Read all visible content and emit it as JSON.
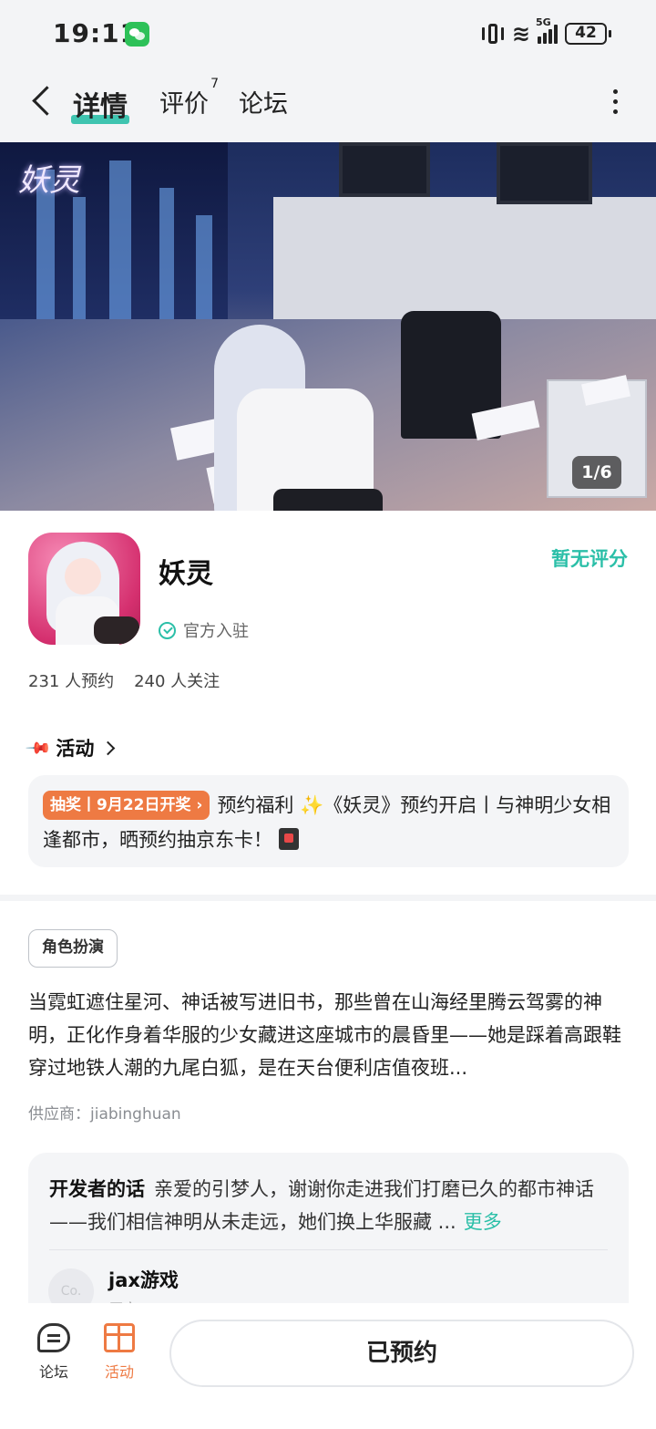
{
  "status_bar": {
    "time": "19:11",
    "network": "5G",
    "battery": "42",
    "icons": [
      "wechat-icon",
      "vibrate-icon",
      "wifi-icon",
      "signal-icon",
      "battery-icon"
    ]
  },
  "nav": {
    "tabs": [
      {
        "label": "详情",
        "active": true
      },
      {
        "label": "评价",
        "badge": "7"
      },
      {
        "label": "论坛"
      }
    ]
  },
  "banner": {
    "logo_text": "妖灵",
    "counter": "1/6"
  },
  "app": {
    "name": "妖灵",
    "official": "官方入驻",
    "rating": "暂无评分",
    "reservations": "231 人预约",
    "followers": "240 人关注"
  },
  "activity": {
    "heading": "活动",
    "badge": "抽奖丨9月22日开奖",
    "text_part1": "预约福利",
    "text_part2": "《妖灵》预约开启丨与神明少女相逢都市，晒预约抽京东卡！"
  },
  "description": {
    "tag": "角色扮演",
    "text": "当霓虹遮住星河、神话被写进旧书，那些曾在山海经里腾云驾雾的神明，正化作身着华服的少女藏进这座城市的晨昏里——她是踩着高跟鞋穿过地铁人潮的九尾白狐，是在天台便利店值夜班...",
    "supplier": "供应商：jiabinghuan"
  },
  "developer": {
    "label": "开发者的话",
    "text": "亲爱的引梦人，谢谢你走进我们打磨已久的都市神话——我们相信神明从未走远，她们换上华服藏 ...",
    "more": "更多",
    "avatar_text": "Co.",
    "name": "jax游戏",
    "role": "厂商"
  },
  "bottom": {
    "forum_label": "论坛",
    "activity_label": "活动",
    "reserve_button": "已预约"
  },
  "colors": {
    "accent_teal": "#2bbfa8",
    "accent_orange": "#ee7a43",
    "background": "#ffffff",
    "card_bg": "#f4f5f7"
  }
}
